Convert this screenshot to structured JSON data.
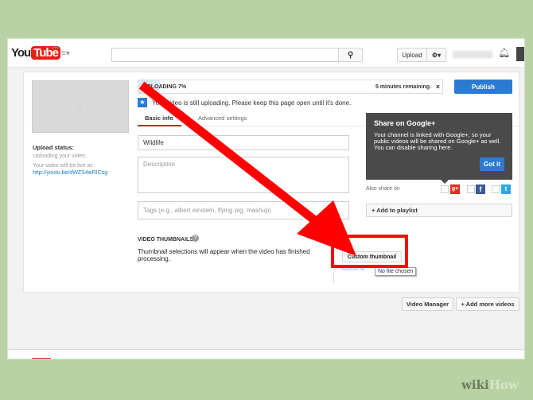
{
  "header": {
    "logo_you": "You",
    "logo_tube": "Tube",
    "region": "PH",
    "search_placeholder": "",
    "upload_label": "Upload"
  },
  "upload": {
    "status_label": "UPLOADING 7%",
    "progress_percent": 7,
    "remaining": "5 minutes remaining.",
    "close": "×",
    "publish_label": "Publish",
    "notice": "Your video is still uploading. Please keep this page open until it's done."
  },
  "left": {
    "status_title": "Upload status:",
    "status_text": "Uploading your video.",
    "live_text": "Your video will be live at:",
    "link": "http://youtu.be/dWZS4wRICsg"
  },
  "tabs": [
    {
      "label": "Basic info",
      "active": true
    },
    {
      "label": "Advanced settings",
      "active": false
    }
  ],
  "form": {
    "title_value": "Wildlife",
    "description_placeholder": "Description",
    "tags_placeholder": "Tags (e.g., albert einstein, flying pig, mashup)"
  },
  "thumbnails": {
    "heading": "VIDEO THUMBNAILS",
    "help": "?",
    "text": "Thumbnail selections will appear when the video has finished processing.",
    "custom_label": "Custom thumbnail",
    "max_text": "Maximum file",
    "no_file": "No file chosen"
  },
  "gplus_tip": {
    "title": "Share on Google+",
    "body": "Your channel is linked with Google+, so your public videos will be shared on Google+ as well. You can disable sharing here.",
    "button": "Got it"
  },
  "share": {
    "label": "Also share on",
    "gplus": "g+",
    "facebook": "f",
    "twitter": "t"
  },
  "playlist_label": "+ Add to playlist",
  "footer_buttons": {
    "video_manager": "Video Manager",
    "add_more": "+ Add more videos"
  },
  "watermark": {
    "wiki": "wiki",
    "how": "How"
  },
  "colors": {
    "accent_red": "#e62117",
    "publish_blue": "#2b7bd3",
    "arrow_red": "#ff0000"
  }
}
